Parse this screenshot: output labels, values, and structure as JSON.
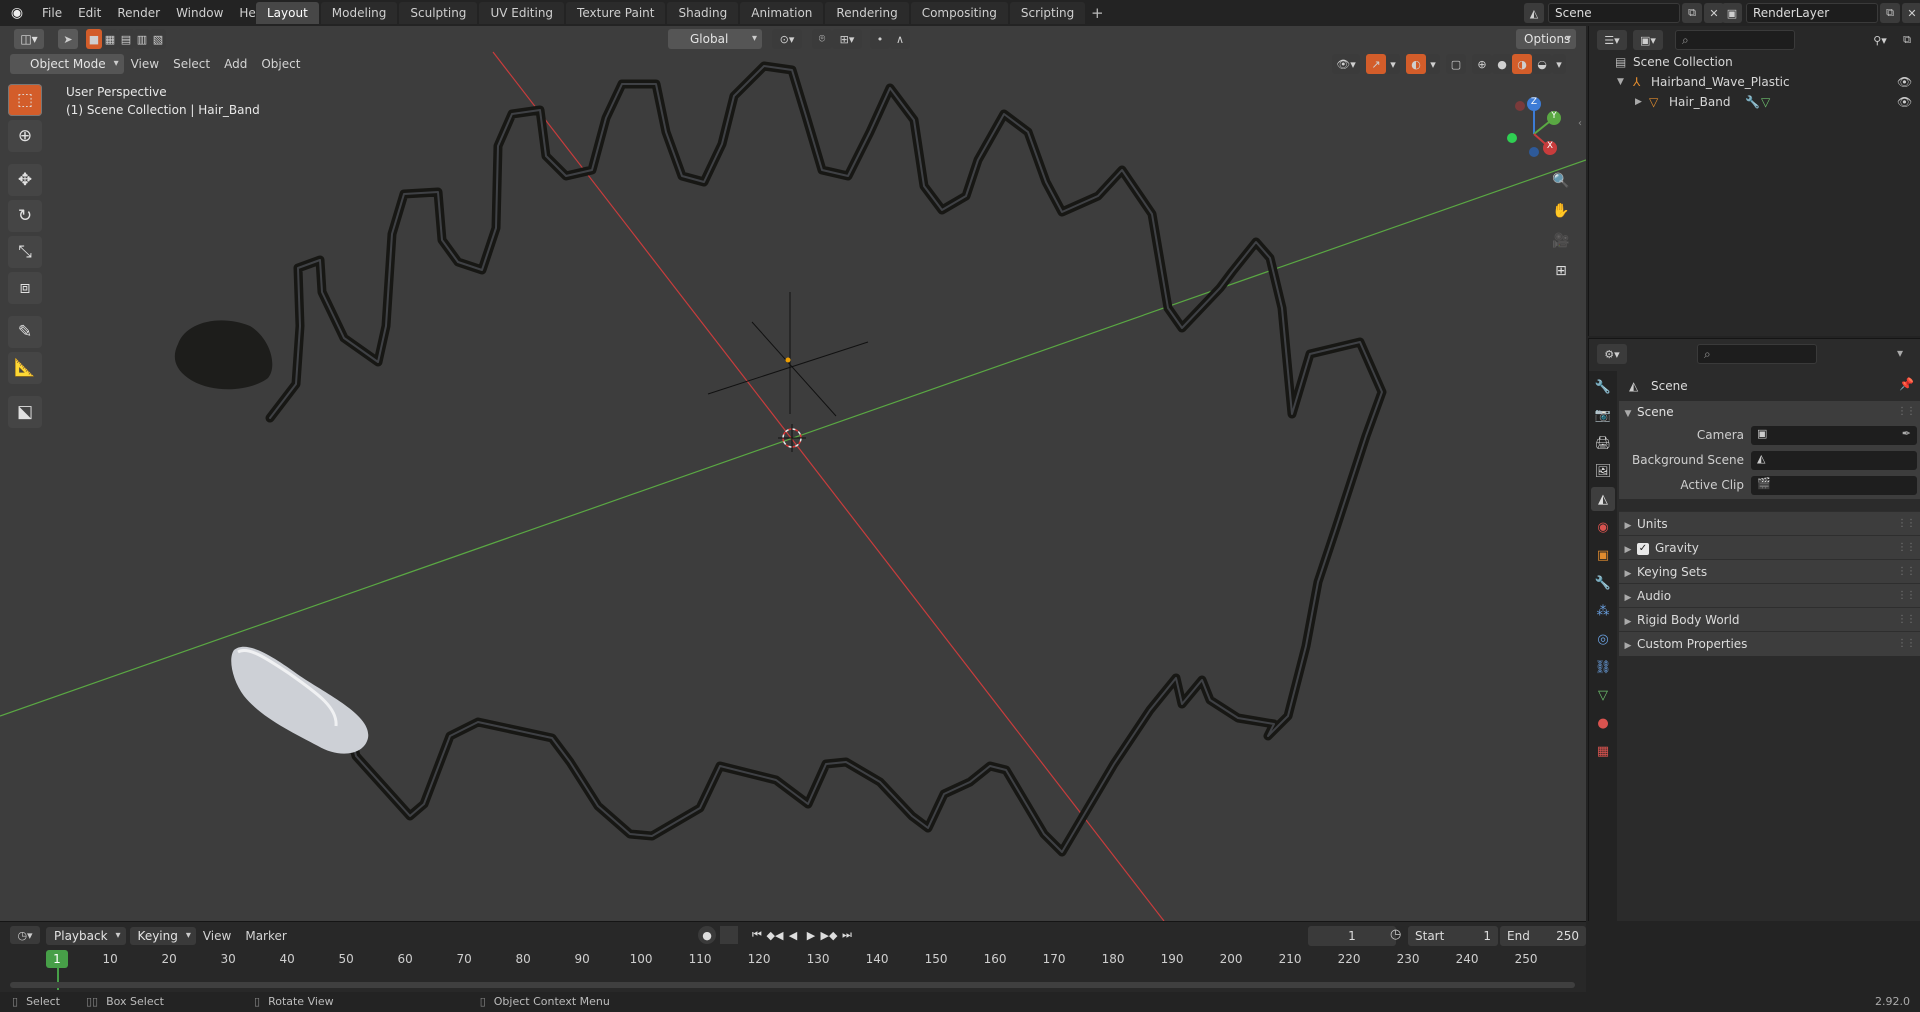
{
  "topbar": {
    "menus": [
      "File",
      "Edit",
      "Render",
      "Window",
      "Help"
    ],
    "workspaces": [
      "Layout",
      "Modeling",
      "Sculpting",
      "UV Editing",
      "Texture Paint",
      "Shading",
      "Animation",
      "Rendering",
      "Compositing",
      "Scripting"
    ],
    "active_workspace": "Layout",
    "scene_name": "Scene",
    "view_layer": "RenderLayer"
  },
  "viewport": {
    "mode": "Object Mode",
    "menus": [
      "View",
      "Select",
      "Add",
      "Object"
    ],
    "orientation": "Global",
    "options_label": "Options",
    "overlay_title": "User Perspective",
    "overlay_subtitle": "(1) Scene Collection | Hair_Band",
    "gizmo": {
      "x": "X",
      "y": "Y",
      "z": "Z"
    },
    "colors": {
      "background": "#3d3d3d",
      "x_axis": "#c83c3c",
      "y_axis": "#5aa843",
      "wire": "#1b1b18"
    }
  },
  "timeline": {
    "menus": [
      "Playback",
      "Keying",
      "View",
      "Marker"
    ],
    "current_frame": "1",
    "start_label": "Start",
    "start_value": "1",
    "end_label": "End",
    "end_value": "250",
    "ticks": [
      "10",
      "20",
      "30",
      "40",
      "50",
      "60",
      "70",
      "80",
      "90",
      "100",
      "110",
      "120",
      "130",
      "140",
      "150",
      "160",
      "170",
      "180",
      "190",
      "200",
      "210",
      "220",
      "230",
      "240",
      "250"
    ],
    "cursor_frame": "1"
  },
  "outliner": {
    "root": "Scene Collection",
    "items": [
      {
        "label": "Hairband_Wave_Plastic",
        "level": 1
      },
      {
        "label": "Hair_Band",
        "level": 2
      }
    ]
  },
  "properties": {
    "context_title": "Scene",
    "panel_title": "Scene",
    "fields": [
      {
        "label": "Camera"
      },
      {
        "label": "Background Scene"
      },
      {
        "label": "Active Clip"
      }
    ],
    "subpanels": [
      "Units",
      "Gravity",
      "Keying Sets",
      "Audio",
      "Rigid Body World",
      "Custom Properties"
    ],
    "gravity_checked": true
  },
  "statusbar": {
    "items": [
      "Select",
      "Box Select",
      "Rotate View",
      "Object Context Menu"
    ],
    "version": "2.92.0"
  }
}
